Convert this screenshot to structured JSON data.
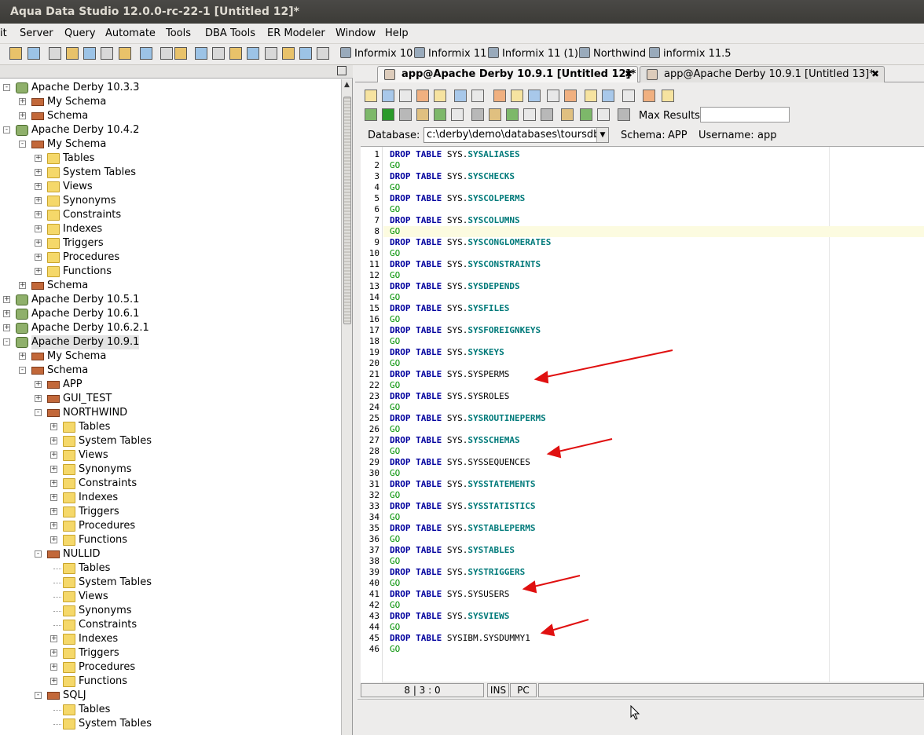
{
  "window_title": "Aqua Data Studio 12.0.0-rc-22-1 [Untitled 12]*",
  "menu": [
    "it",
    "Server",
    "Query",
    "Automate",
    "Tools",
    "DBA Tools",
    "ER Modeler",
    "Window",
    "Help"
  ],
  "toolbar_connections": [
    "Informix 10",
    "Informix 11",
    "Informix 11 (1)",
    "Northwind",
    "informix 11.5"
  ],
  "tree": [
    {
      "label": "Apache Derby 10.3.3",
      "level": 0,
      "icon": "database-icon",
      "expander": "-"
    },
    {
      "label": "My Schema",
      "level": 1,
      "icon": "schema-icon",
      "expander": "+"
    },
    {
      "label": "Schema",
      "level": 1,
      "icon": "schema-icon",
      "expander": "+"
    },
    {
      "label": "Apache Derby 10.4.2",
      "level": 0,
      "icon": "database-icon",
      "expander": "-"
    },
    {
      "label": "My Schema",
      "level": 1,
      "icon": "schema-icon",
      "expander": "-"
    },
    {
      "label": "Tables",
      "level": 2,
      "icon": "folder-icon",
      "expander": "+"
    },
    {
      "label": "System Tables",
      "level": 2,
      "icon": "folder-icon",
      "expander": "+"
    },
    {
      "label": "Views",
      "level": 2,
      "icon": "folder-icon",
      "expander": "+"
    },
    {
      "label": "Synonyms",
      "level": 2,
      "icon": "folder-icon",
      "expander": "+"
    },
    {
      "label": "Constraints",
      "level": 2,
      "icon": "folder-icon",
      "expander": "+"
    },
    {
      "label": "Indexes",
      "level": 2,
      "icon": "folder-icon",
      "expander": "+"
    },
    {
      "label": "Triggers",
      "level": 2,
      "icon": "folder-icon",
      "expander": "+"
    },
    {
      "label": "Procedures",
      "level": 2,
      "icon": "folder-icon",
      "expander": "+"
    },
    {
      "label": "Functions",
      "level": 2,
      "icon": "folder-icon",
      "expander": "+"
    },
    {
      "label": "Schema",
      "level": 1,
      "icon": "schema-icon",
      "expander": "+"
    },
    {
      "label": "Apache Derby 10.5.1",
      "level": 0,
      "icon": "database-icon",
      "expander": "+"
    },
    {
      "label": "Apache Derby 10.6.1",
      "level": 0,
      "icon": "database-icon",
      "expander": "+"
    },
    {
      "label": "Apache Derby 10.6.2.1",
      "level": 0,
      "icon": "database-icon",
      "expander": "+"
    },
    {
      "label": "Apache Derby 10.9.1",
      "level": 0,
      "icon": "database-icon",
      "expander": "-",
      "selected": true
    },
    {
      "label": "My Schema",
      "level": 1,
      "icon": "schema-icon",
      "expander": "+"
    },
    {
      "label": "Schema",
      "level": 1,
      "icon": "schema-icon",
      "expander": "-"
    },
    {
      "label": "APP",
      "level": 2,
      "icon": "schema-icon",
      "expander": "+"
    },
    {
      "label": "GUI_TEST",
      "level": 2,
      "icon": "schema-icon",
      "expander": "+"
    },
    {
      "label": "NORTHWIND",
      "level": 2,
      "icon": "schema-icon",
      "expander": "-"
    },
    {
      "label": "Tables",
      "level": 3,
      "icon": "folder-icon",
      "expander": "+"
    },
    {
      "label": "System Tables",
      "level": 3,
      "icon": "folder-icon",
      "expander": "+"
    },
    {
      "label": "Views",
      "level": 3,
      "icon": "folder-icon",
      "expander": "+"
    },
    {
      "label": "Synonyms",
      "level": 3,
      "icon": "folder-icon",
      "expander": "+"
    },
    {
      "label": "Constraints",
      "level": 3,
      "icon": "folder-icon",
      "expander": "+"
    },
    {
      "label": "Indexes",
      "level": 3,
      "icon": "folder-icon",
      "expander": "+"
    },
    {
      "label": "Triggers",
      "level": 3,
      "icon": "folder-icon",
      "expander": "+"
    },
    {
      "label": "Procedures",
      "level": 3,
      "icon": "folder-icon",
      "expander": "+"
    },
    {
      "label": "Functions",
      "level": 3,
      "icon": "folder-icon",
      "expander": "+"
    },
    {
      "label": "NULLID",
      "level": 2,
      "icon": "schema-icon",
      "expander": "-"
    },
    {
      "label": "Tables",
      "level": 3,
      "icon": "folder-icon",
      "expander": ""
    },
    {
      "label": "System Tables",
      "level": 3,
      "icon": "folder-icon",
      "expander": ""
    },
    {
      "label": "Views",
      "level": 3,
      "icon": "folder-icon",
      "expander": ""
    },
    {
      "label": "Synonyms",
      "level": 3,
      "icon": "folder-icon",
      "expander": ""
    },
    {
      "label": "Constraints",
      "level": 3,
      "icon": "folder-icon",
      "expander": ""
    },
    {
      "label": "Indexes",
      "level": 3,
      "icon": "folder-icon",
      "expander": "+"
    },
    {
      "label": "Triggers",
      "level": 3,
      "icon": "folder-icon",
      "expander": "+"
    },
    {
      "label": "Procedures",
      "level": 3,
      "icon": "folder-icon",
      "expander": "+"
    },
    {
      "label": "Functions",
      "level": 3,
      "icon": "folder-icon",
      "expander": "+"
    },
    {
      "label": "SQLJ",
      "level": 2,
      "icon": "schema-icon",
      "expander": "-"
    },
    {
      "label": "Tables",
      "level": 3,
      "icon": "folder-icon",
      "expander": ""
    },
    {
      "label": "System Tables",
      "level": 3,
      "icon": "folder-icon",
      "expander": ""
    }
  ],
  "tabs": [
    {
      "label": "app@Apache Derby 10.9.1 [Untitled 12]*",
      "active": true,
      "close": "✖"
    },
    {
      "label": "app@Apache Derby 10.9.1 [Untitled 13]*",
      "active": false,
      "close": "✖"
    }
  ],
  "query_toolbar": {
    "max_results_label": "Max Results:",
    "max_results_value": ""
  },
  "database_bar": {
    "database_label": "Database:",
    "database_value": "c:\\derby\\demo\\databases\\toursdb",
    "schema_label": "Schema:",
    "schema_value": "APP",
    "username_label": "Username:",
    "username_value": "app"
  },
  "editor": {
    "current_line": 8,
    "lines": [
      {
        "n": "1",
        "kw": "DROP TABLE",
        "schema": "SYS.",
        "table": "SYSALIASES",
        "hl": true
      },
      {
        "n": "2",
        "go": "GO"
      },
      {
        "n": "3",
        "kw": "DROP TABLE",
        "schema": "SYS.",
        "table": "SYSCHECKS",
        "hl": true
      },
      {
        "n": "4",
        "go": "GO"
      },
      {
        "n": "5",
        "kw": "DROP TABLE",
        "schema": "SYS.",
        "table": "SYSCOLPERMS",
        "hl": true
      },
      {
        "n": "6",
        "go": "GO"
      },
      {
        "n": "7",
        "kw": "DROP TABLE",
        "schema": "SYS.",
        "table": "SYSCOLUMNS",
        "hl": true
      },
      {
        "n": "8",
        "go": "GO"
      },
      {
        "n": "9",
        "kw": "DROP TABLE",
        "schema": "SYS.",
        "table": "SYSCONGLOMERATES",
        "hl": true
      },
      {
        "n": "10",
        "go": "GO"
      },
      {
        "n": "11",
        "kw": "DROP TABLE",
        "schema": "SYS.",
        "table": "SYSCONSTRAINTS",
        "hl": true
      },
      {
        "n": "12",
        "go": "GO"
      },
      {
        "n": "13",
        "kw": "DROP TABLE",
        "schema": "SYS.",
        "table": "SYSDEPENDS",
        "hl": true
      },
      {
        "n": "14",
        "go": "GO"
      },
      {
        "n": "15",
        "kw": "DROP TABLE",
        "schema": "SYS.",
        "table": "SYSFILES",
        "hl": true
      },
      {
        "n": "16",
        "go": "GO"
      },
      {
        "n": "17",
        "kw": "DROP TABLE",
        "schema": "SYS.",
        "table": "SYSFOREIGNKEYS",
        "hl": true
      },
      {
        "n": "18",
        "go": "GO"
      },
      {
        "n": "19",
        "kw": "DROP TABLE",
        "schema": "SYS.",
        "table": "SYSKEYS",
        "hl": true
      },
      {
        "n": "20",
        "go": "GO"
      },
      {
        "n": "21",
        "kw": "DROP TABLE",
        "schema": "SYS.",
        "table": "SYSPERMS",
        "hl": false
      },
      {
        "n": "22",
        "go": "GO"
      },
      {
        "n": "23",
        "kw": "DROP TABLE",
        "schema": "SYS.",
        "table": "SYSROLES",
        "hl": false
      },
      {
        "n": "24",
        "go": "GO"
      },
      {
        "n": "25",
        "kw": "DROP TABLE",
        "schema": "SYS.",
        "table": "SYSROUTINEPERMS",
        "hl": true
      },
      {
        "n": "26",
        "go": "GO"
      },
      {
        "n": "27",
        "kw": "DROP TABLE",
        "schema": "SYS.",
        "table": "SYSSCHEMAS",
        "hl": true
      },
      {
        "n": "28",
        "go": "GO"
      },
      {
        "n": "29",
        "kw": "DROP TABLE",
        "schema": "SYS.",
        "table": "SYSSEQUENCES",
        "hl": false
      },
      {
        "n": "30",
        "go": "GO"
      },
      {
        "n": "31",
        "kw": "DROP TABLE",
        "schema": "SYS.",
        "table": "SYSSTATEMENTS",
        "hl": true
      },
      {
        "n": "32",
        "go": "GO"
      },
      {
        "n": "33",
        "kw": "DROP TABLE",
        "schema": "SYS.",
        "table": "SYSSTATISTICS",
        "hl": true
      },
      {
        "n": "34",
        "go": "GO"
      },
      {
        "n": "35",
        "kw": "DROP TABLE",
        "schema": "SYS.",
        "table": "SYSTABLEPERMS",
        "hl": true
      },
      {
        "n": "36",
        "go": "GO"
      },
      {
        "n": "37",
        "kw": "DROP TABLE",
        "schema": "SYS.",
        "table": "SYSTABLES",
        "hl": true
      },
      {
        "n": "38",
        "go": "GO"
      },
      {
        "n": "39",
        "kw": "DROP TABLE",
        "schema": "SYS.",
        "table": "SYSTRIGGERS",
        "hl": true
      },
      {
        "n": "40",
        "go": "GO"
      },
      {
        "n": "41",
        "kw": "DROP TABLE",
        "schema": "SYS.",
        "table": "SYSUSERS",
        "hl": false
      },
      {
        "n": "42",
        "go": "GO"
      },
      {
        "n": "43",
        "kw": "DROP TABLE",
        "schema": "SYS.",
        "table": "SYSVIEWS",
        "hl": true
      },
      {
        "n": "44",
        "go": "GO"
      },
      {
        "n": "45",
        "kw": "DROP TABLE",
        "schema": "",
        "table": "SYSIBM.SYSDUMMY1",
        "hl": false
      },
      {
        "n": "46",
        "go": "GO"
      }
    ]
  },
  "statusbar": {
    "position": "8 | 3 : 0",
    "mode1": "INS",
    "mode2": "PC"
  },
  "colors": {
    "keyword": "#00009e",
    "table_name": "#007a7a",
    "go": "#009000",
    "annotation_arrow": "#e01010"
  }
}
